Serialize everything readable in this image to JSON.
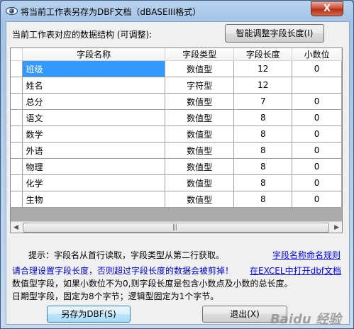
{
  "window": {
    "title": "将当前工作表另存为DBF文档（dBASEIII格式）",
    "close_label": "X"
  },
  "struct_label": "当前工作表对应的数据结构 (可调整):",
  "smart_button_label": "智能调整字段长度(I)",
  "grid": {
    "columns": [
      "字段名称",
      "字段类型",
      "字段长度",
      "小数位"
    ],
    "rows": [
      {
        "name": "班级",
        "type": "数值型",
        "length": "12",
        "decimals": "0"
      },
      {
        "name": "姓名",
        "type": "字符型",
        "length": "12",
        "decimals": ""
      },
      {
        "name": "总分",
        "type": "数值型",
        "length": "7",
        "decimals": "0"
      },
      {
        "name": "语文",
        "type": "数值型",
        "length": "8",
        "decimals": "0"
      },
      {
        "name": "数学",
        "type": "数值型",
        "length": "8",
        "decimals": "0"
      },
      {
        "name": "外语",
        "type": "数值型",
        "length": "8",
        "decimals": "0"
      },
      {
        "name": "物理",
        "type": "数值型",
        "length": "8",
        "decimals": "0"
      },
      {
        "name": "化学",
        "type": "数值型",
        "length": "8",
        "decimals": "0"
      },
      {
        "name": "生物",
        "type": "数值型",
        "length": "8",
        "decimals": "0"
      }
    ],
    "scroll_left": "◀",
    "scroll_right": "▶",
    "scroll_grip": "|||"
  },
  "tip": "提示：字段名从首行读取，字段类型从第二行获取。",
  "naming_link": "字段名称命名规则",
  "warn_line": "请合理设置字段长度，否则超过字段长度的数据会被剪掉！",
  "open_link": "在EXCEL中打开dbf文档",
  "line3": "数值型字段，如果小数位不为0,则字段长度是包含小数点及小数的总长度。",
  "line4": "日期型字段，固定为8个字节；逻辑型固定为1个字节。",
  "save_button_label": "另存为DBF(S)",
  "exit_button_label": "退出(X)",
  "watermark": "Baidu 经验"
}
